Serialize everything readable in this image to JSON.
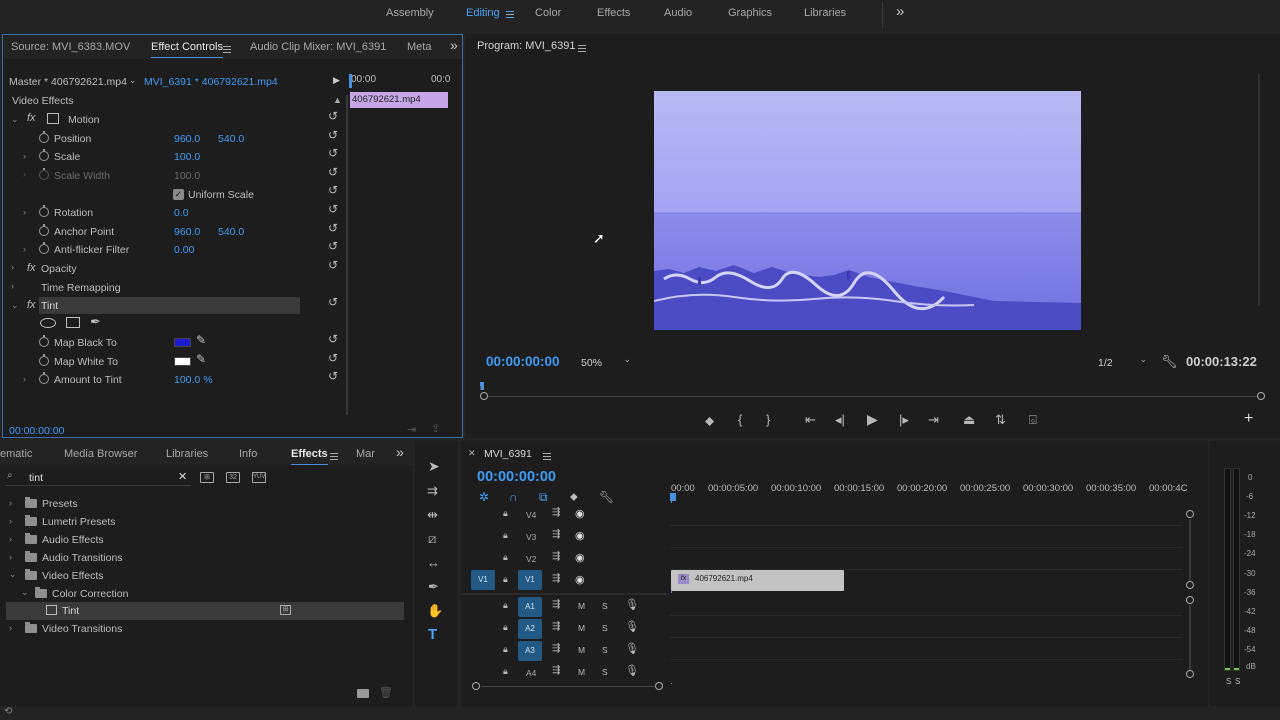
{
  "workspaces": {
    "items": [
      "Assembly",
      "Editing",
      "Color",
      "Effects",
      "Audio",
      "Graphics",
      "Libraries"
    ],
    "active": "Editing",
    "more_glyph": "»"
  },
  "source_panel": {
    "tabs": [
      "Source: MVI_6383.MOV",
      "Effect Controls",
      "Audio Clip Mixer: MVI_6391",
      "Meta"
    ],
    "active_tab": "Effect Controls",
    "master_label": "Master * 406792621.mp4",
    "clip_label": "MVI_6391 * 406792621.mp4",
    "timeline_start": "00:00",
    "timeline_end": "00:0",
    "clip_bar": "406792621.mp4",
    "section": "Video Effects",
    "timecode": "00:00:00:00",
    "motion": {
      "label": "Motion",
      "position_label": "Position",
      "position_x": "960.0",
      "position_y": "540.0",
      "scale_label": "Scale",
      "scale": "100.0",
      "scale_width_label": "Scale Width",
      "scale_width": "100.0",
      "uniform_scale_label": "Uniform Scale",
      "rotation_label": "Rotation",
      "rotation": "0.0",
      "anchor_label": "Anchor Point",
      "anchor_x": "960.0",
      "anchor_y": "540.0",
      "antiflicker_label": "Anti-flicker Filter",
      "antiflicker": "0.00"
    },
    "opacity_label": "Opacity",
    "time_remap_label": "Time Remapping",
    "tint": {
      "label": "Tint",
      "map_black_label": "Map Black To",
      "map_black_color": "#1b1bd0",
      "map_white_label": "Map White To",
      "map_white_color": "#ffffff",
      "amount_label": "Amount to Tint",
      "amount": "100.0 %"
    }
  },
  "program": {
    "title": "Program: MVI_6391",
    "timecode": "00:00:00:00",
    "zoom": "50%",
    "resolution": "1/2",
    "duration": "00:00:13:22",
    "tint_color": "#7878e8"
  },
  "project_panel": {
    "tabs": [
      "ematic",
      "Media Browser",
      "Libraries",
      "Info",
      "Effects",
      "Mar"
    ],
    "active_tab": "Effects",
    "search_value": "tint",
    "tree": [
      {
        "label": "Presets",
        "level": 0,
        "open": false
      },
      {
        "label": "Lumetri Presets",
        "level": 0,
        "open": false
      },
      {
        "label": "Audio Effects",
        "level": 0,
        "open": false
      },
      {
        "label": "Audio Transitions",
        "level": 0,
        "open": false
      },
      {
        "label": "Video Effects",
        "level": 0,
        "open": true
      },
      {
        "label": "Color Correction",
        "level": 1,
        "open": true
      },
      {
        "label": "Tint",
        "level": 2,
        "open": false
      },
      {
        "label": "Video Transitions",
        "level": 0,
        "open": false
      }
    ]
  },
  "timeline": {
    "title": "MVI_6391",
    "timecode": "00:00:00:00",
    "ruler": [
      "00:00",
      "00:00:05:00",
      "00:00:10:00",
      "00:00:15:00",
      "00:00:20:00",
      "00:00:25:00",
      "00:00:30:00",
      "00:00:35:00",
      "00:00:4C"
    ],
    "video_tracks": [
      "V4",
      "V3",
      "V2",
      "V1"
    ],
    "audio_tracks": [
      "A1",
      "A2",
      "A3",
      "A4"
    ],
    "source_patch_v": "V1",
    "mute_label": "M",
    "solo_label": "S",
    "clip_label": "406792621.mp4",
    "fx_badge": "fx"
  },
  "meter": {
    "labels": [
      "0",
      "-6",
      "-12",
      "-18",
      "-24",
      "-30",
      "-36",
      "-42",
      "-48",
      "-54",
      "dB"
    ],
    "solo_labels": [
      "S",
      "S"
    ]
  }
}
